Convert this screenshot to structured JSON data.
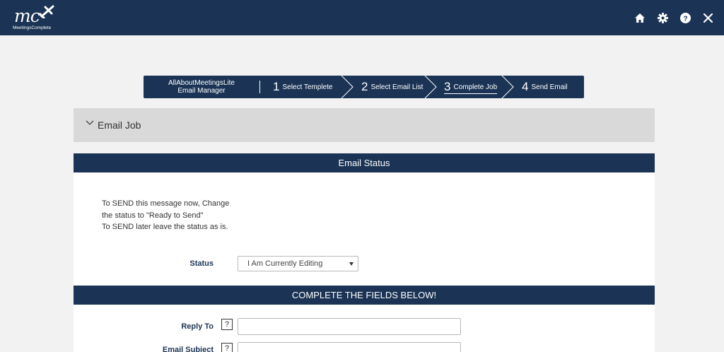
{
  "header": {
    "logo_text": "mc",
    "logo_tagline": "MeetingsComplete",
    "icons": [
      "home-icon",
      "gear-icon",
      "help-icon",
      "close-icon"
    ]
  },
  "wizard": {
    "title_line1": "AllAboutMeetingsLite",
    "title_line2": "Email Manager",
    "steps": [
      {
        "num": "1",
        "label": "Select Templete"
      },
      {
        "num": "2",
        "label": "Select Email List"
      },
      {
        "num": "3",
        "label": "Complete Job",
        "active": true
      },
      {
        "num": "4",
        "label": "Send Email"
      }
    ]
  },
  "panel": {
    "title": "Email Job"
  },
  "status_section": {
    "header": "Email Status",
    "instructions": [
      "To SEND this message now, Change",
      "the status to \"Ready to Send\"",
      "To SEND later leave the status as is."
    ],
    "status_label": "Status",
    "status_value": "I Am Currently Editing"
  },
  "fields_section": {
    "header": "COMPLETE THE FIELDS BELOW!",
    "reply_to_label": "Reply To",
    "reply_to_value": "",
    "email_subject_label": "Email Subject",
    "email_subject_value": "",
    "help_glyph": "?"
  },
  "colors": {
    "navy": "#1b3455",
    "page_bg": "#f2f2f2",
    "panel_bg": "#d9d9d9"
  }
}
